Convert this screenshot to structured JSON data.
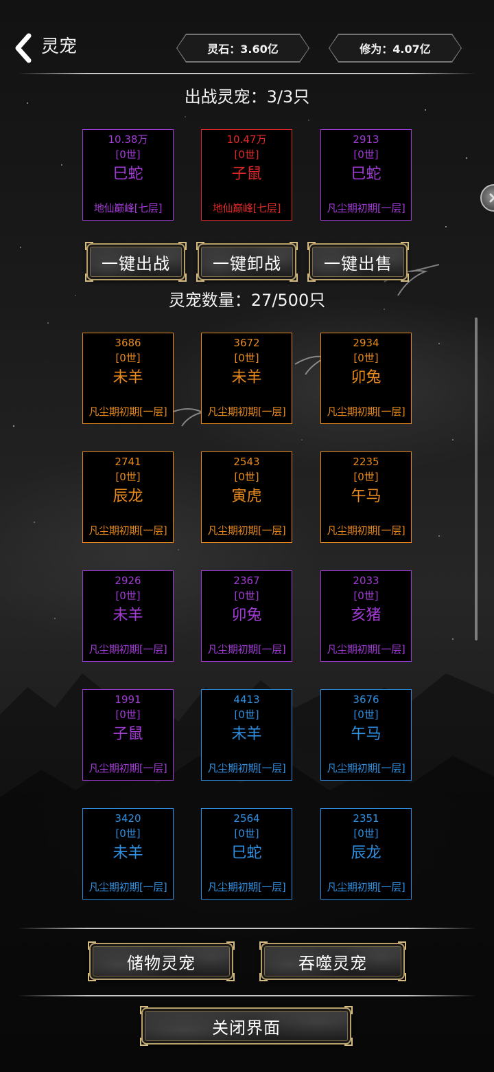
{
  "header": {
    "title": "灵宠",
    "spirit_stone": "灵石：3.60亿",
    "cultivation": "修为：4.07亿"
  },
  "deployed": {
    "title": "出战灵宠：3/3只",
    "pets": [
      {
        "power": "10.38万",
        "gen": "[0世]",
        "name": "巳蛇",
        "realm": "地仙巅峰[七层]",
        "color": "#a23bd6"
      },
      {
        "power": "10.47万",
        "gen": "[0世]",
        "name": "子鼠",
        "realm": "地仙巅峰[七层]",
        "color": "#e02828"
      },
      {
        "power": "2913",
        "gen": "[0世]",
        "name": "巳蛇",
        "realm": "凡尘期初期[一层]",
        "color": "#a23bd6"
      }
    ]
  },
  "actions": {
    "deploy_all": "一键出战",
    "recall_all": "一键卸战",
    "sell_all": "一键出售"
  },
  "collection": {
    "title": "灵宠数量：27/500只",
    "pets": [
      {
        "power": "3686",
        "gen": "[0世]",
        "name": "未羊",
        "realm": "凡尘期初期[一层]",
        "color": "#e88a1c"
      },
      {
        "power": "3672",
        "gen": "[0世]",
        "name": "未羊",
        "realm": "凡尘期初期[一层]",
        "color": "#e88a1c"
      },
      {
        "power": "2934",
        "gen": "[0世]",
        "name": "卯兔",
        "realm": "凡尘期初期[一层]",
        "color": "#e88a1c"
      },
      {
        "power": "2741",
        "gen": "[0世]",
        "name": "辰龙",
        "realm": "凡尘期初期[一层]",
        "color": "#e88a1c"
      },
      {
        "power": "2543",
        "gen": "[0世]",
        "name": "寅虎",
        "realm": "凡尘期初期[一层]",
        "color": "#e88a1c"
      },
      {
        "power": "2235",
        "gen": "[0世]",
        "name": "午马",
        "realm": "凡尘期初期[一层]",
        "color": "#e88a1c"
      },
      {
        "power": "2926",
        "gen": "[0世]",
        "name": "未羊",
        "realm": "凡尘期初期[一层]",
        "color": "#a23bd6"
      },
      {
        "power": "2367",
        "gen": "[0世]",
        "name": "卯兔",
        "realm": "凡尘期初期[一层]",
        "color": "#a23bd6"
      },
      {
        "power": "2033",
        "gen": "[0世]",
        "name": "亥猪",
        "realm": "凡尘期初期[一层]",
        "color": "#a23bd6"
      },
      {
        "power": "1991",
        "gen": "[0世]",
        "name": "子鼠",
        "realm": "凡尘期初期[一层]",
        "color": "#a23bd6"
      },
      {
        "power": "4413",
        "gen": "[0世]",
        "name": "未羊",
        "realm": "凡尘期初期[一层]",
        "color": "#2f8fe0"
      },
      {
        "power": "3676",
        "gen": "[0世]",
        "name": "午马",
        "realm": "凡尘期初期[一层]",
        "color": "#2f8fe0"
      },
      {
        "power": "3420",
        "gen": "[0世]",
        "name": "未羊",
        "realm": "凡尘期初期[一层]",
        "color": "#2f8fe0"
      },
      {
        "power": "2564",
        "gen": "[0世]",
        "name": "巳蛇",
        "realm": "凡尘期初期[一层]",
        "color": "#2f8fe0"
      },
      {
        "power": "2351",
        "gen": "[0世]",
        "name": "辰龙",
        "realm": "凡尘期初期[一层]",
        "color": "#2f8fe0"
      }
    ]
  },
  "footer": {
    "storage": "储物灵宠",
    "devour": "吞噬灵宠",
    "close": "关闭界面"
  }
}
